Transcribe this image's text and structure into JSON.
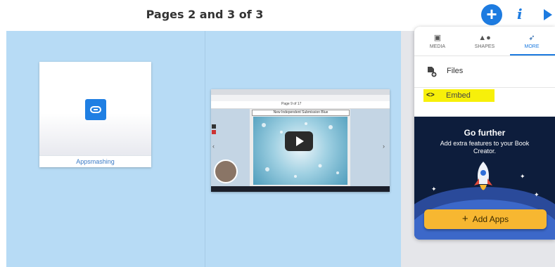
{
  "header": {
    "title": "Pages 2 and 3 of 3",
    "add_icon": "+",
    "info_icon": "i",
    "play_icon": "play-icon"
  },
  "canvas": {
    "link_widget": {
      "label": "Appsmashing",
      "icon": "link-icon",
      "accent": "#1f7fe3"
    },
    "video_embed": {
      "page_title": "Page 9 of 17",
      "caption": "New Independent Submission Blue",
      "play_icon": "play-icon",
      "left_arrow": "‹",
      "right_arrow": "›"
    }
  },
  "panel": {
    "tabs": [
      {
        "label": "MEDIA",
        "icon": "media-icon"
      },
      {
        "label": "SHAPES",
        "icon": "shapes-icon"
      },
      {
        "label": "MORE",
        "icon": "rocket-icon",
        "active": true
      }
    ],
    "items": [
      {
        "label": "Files",
        "icon": "file-plus-icon"
      },
      {
        "label": "Embed",
        "icon": "<>",
        "highlight": "#f7f00a"
      }
    ],
    "promo": {
      "title": "Go further",
      "text": "Add extra features to your Book Creator.",
      "button_label": "Add Apps",
      "button_color": "#f7b731"
    }
  },
  "colors": {
    "accent": "#1d7be0",
    "canvas_bg": "#b7dbf5"
  }
}
